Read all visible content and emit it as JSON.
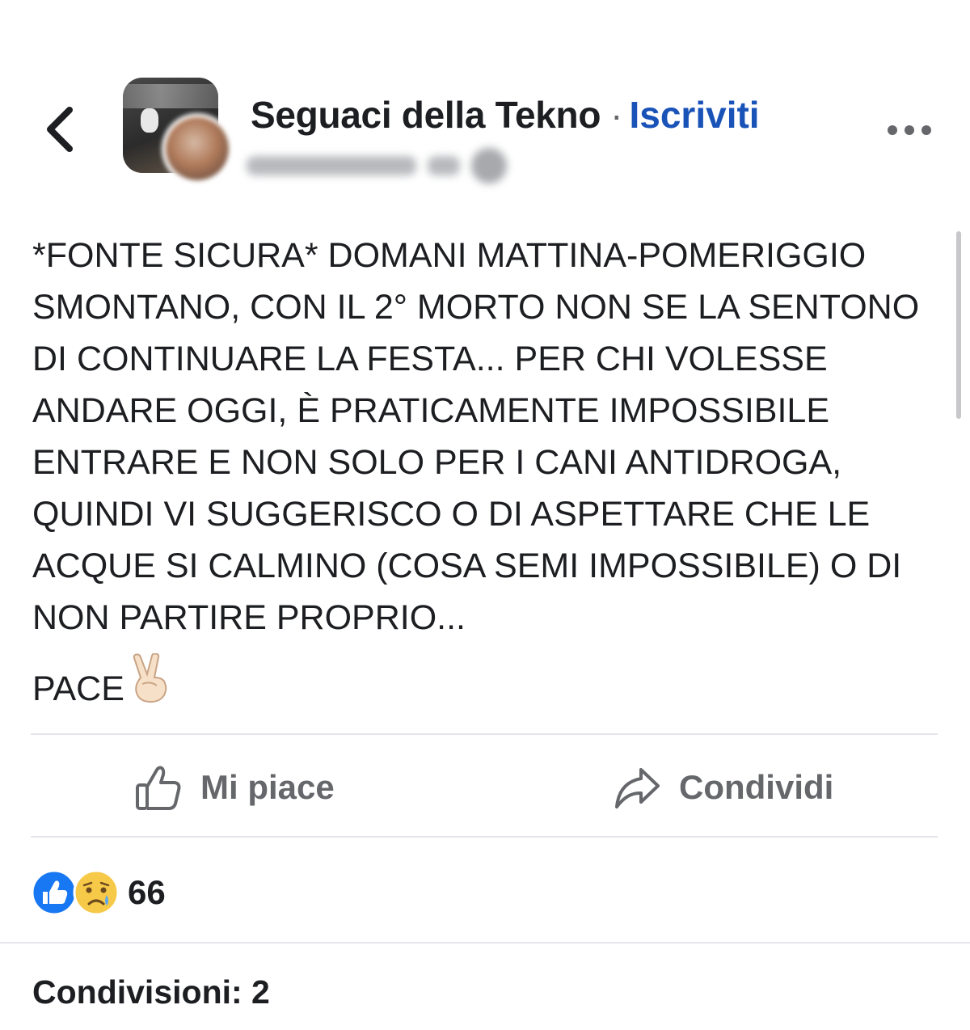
{
  "header": {
    "back_icon": "chevron-left-icon",
    "group_name": "Seguaci della Tekno",
    "separator": "·",
    "join_label": "Iscriviti",
    "more_icon": "more-horizontal-icon"
  },
  "post": {
    "text": "*FONTE SICURA* DOMANI MATTINA-POMERIGGIO SMONTANO, CON IL 2° MORTO NON SE LA SENTONO DI CONTINUARE LA FESTA... PER CHI VOLESSE ANDARE OGGI, È PRATICAMENTE IMPOSSIBILE ENTRARE E NON SOLO PER I CANI ANTIDROGA, QUINDI VI SUGGERISCO O DI ASPETTARE CHE LE ACQUE SI CALMINO (COSA SEMI IMPOSSIBILE) O DI NON PARTIRE PROPRIO...",
    "sign_off": "PACE",
    "sign_off_emoji": "victory-hand-emoji"
  },
  "actions": {
    "like_label": "Mi piace",
    "like_icon": "thumbs-up-icon",
    "share_label": "Condividi",
    "share_icon": "share-arrow-icon"
  },
  "reactions": {
    "types": [
      "like",
      "sad"
    ],
    "count": "66"
  },
  "shares_label": "Condivisioni: 2",
  "colors": {
    "link_blue": "#1a53b8",
    "secondary_text": "#65676b",
    "like_blue": "#1877f2",
    "divider": "#e4e6eb"
  }
}
